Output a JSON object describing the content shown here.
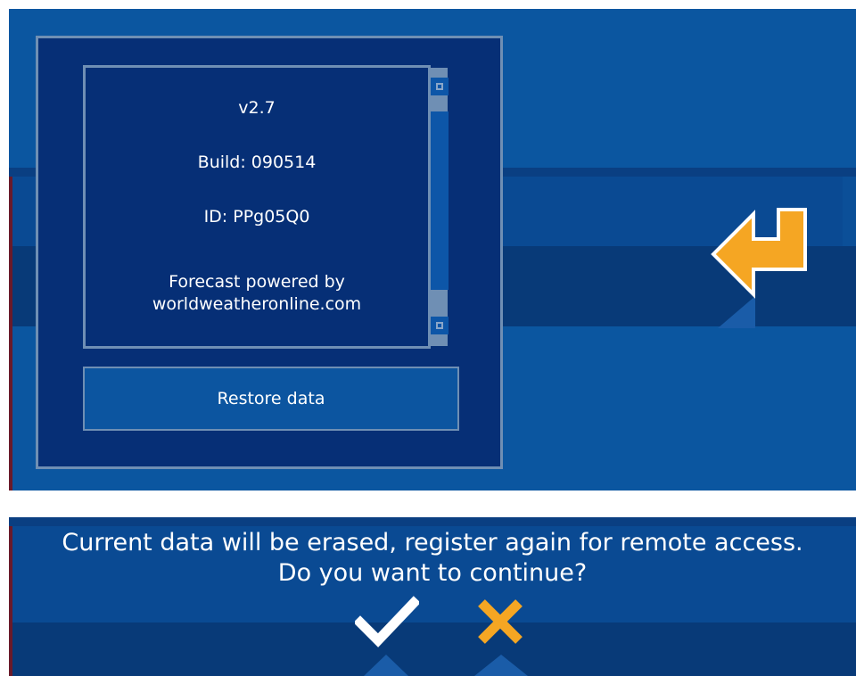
{
  "about_dialog": {
    "version": "v2.7",
    "build": "Build: 090514",
    "id": "ID: PPg05Q0",
    "forecast_line1": "Forecast powered by",
    "forecast_line2": "worldweatheronline.com",
    "restore_label": "Restore data"
  },
  "navigation": {
    "back_icon": "return-arrow-icon"
  },
  "confirm_dialog": {
    "message_line1": "Current data will be erased, register again for remote access.",
    "message_line2": "Do you want to continue?",
    "ok_icon": "checkmark-icon",
    "cancel_icon": "cross-icon"
  },
  "colors": {
    "background": "#0b56a0",
    "dialog": "#062f76",
    "border": "#6f8fb4",
    "accent": "#f5a623",
    "text": "#ffffff"
  }
}
